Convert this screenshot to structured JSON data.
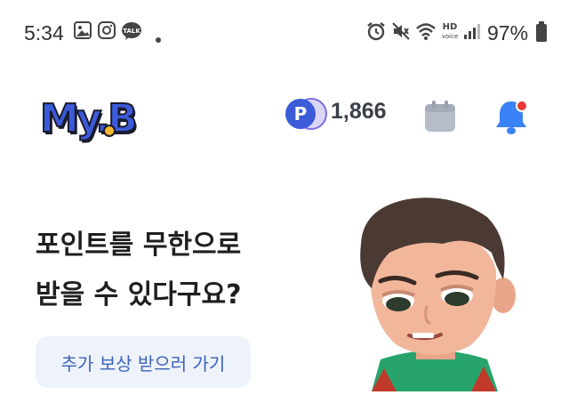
{
  "status_bar": {
    "time": "5:34",
    "battery": "97%"
  },
  "header": {
    "logo_text": "My.B",
    "points_badge_letter": "P",
    "points": "1,866",
    "icons": [
      "points-icon",
      "calendar-icon",
      "bell-icon"
    ],
    "notification_dot_color": "#e53935"
  },
  "promo": {
    "headline_line1": "포인트를 무한으로",
    "headline_line2": "받을 수 있다구요?",
    "cta_label": "추가 보상 받으러 가기"
  },
  "colors": {
    "accent": "#3b63b9",
    "bell": "#3b82f6",
    "cta_bg": "#eef2fb"
  }
}
